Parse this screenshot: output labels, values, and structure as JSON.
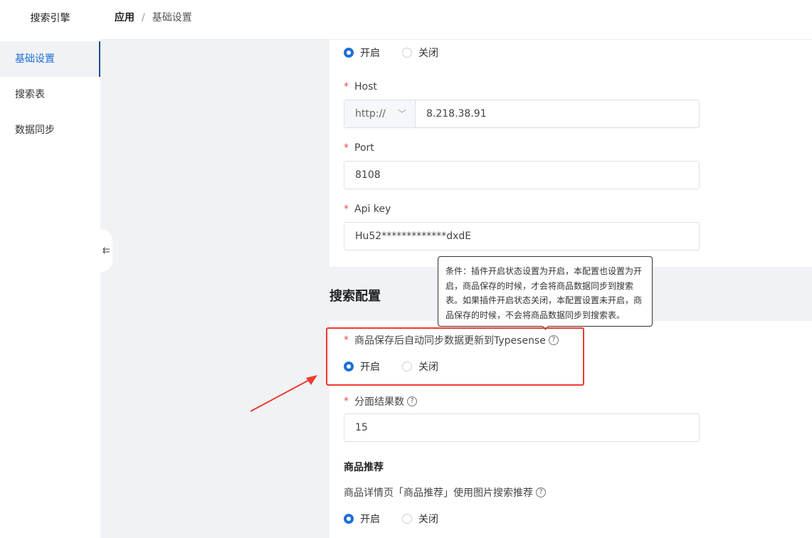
{
  "sidebar": {
    "app_title": "搜索引擎",
    "items": [
      {
        "label": "基础设置",
        "active": true
      },
      {
        "label": "搜索表",
        "active": false
      },
      {
        "label": "数据同步",
        "active": false
      }
    ]
  },
  "header": {
    "breadcrumb_app": "应用",
    "breadcrumb_sep": "/",
    "breadcrumb_current": "基础设置"
  },
  "plugin_status": {
    "on_label": "开启",
    "off_label": "关闭",
    "selected": "on"
  },
  "host": {
    "label": "Host",
    "protocol": "http://",
    "value": "8.218.38.91"
  },
  "port": {
    "label": "Port",
    "value": "8108"
  },
  "api_key": {
    "label": "Api key",
    "value": "Hu52*************dxdE"
  },
  "search_config": {
    "heading": "搜索配置",
    "auto_sync": {
      "label": "商品保存后自动同步数据更新到Typesense",
      "on_label": "开启",
      "off_label": "关闭",
      "selected": "on"
    },
    "facet_count": {
      "label": "分面结果数",
      "value": "15"
    }
  },
  "tooltip": {
    "text": "条件：插件开启状态设置为开启，本配置也设置为开启，商品保存的时候，才会将商品数据同步到搜索表。如果插件开启状态关闭，本配置设置未开启，商品保存的时候，不会将商品数据同步到搜索表。"
  },
  "product_recommend": {
    "heading": "商品推荐",
    "label": "商品详情页「商品推荐」使用图片搜索推荐",
    "on_label": "开启",
    "off_label": "关闭",
    "selected": "on"
  },
  "colors": {
    "accent": "#1f6fd6",
    "annotation": "#ee3b2f",
    "required": "#f04a4a"
  }
}
